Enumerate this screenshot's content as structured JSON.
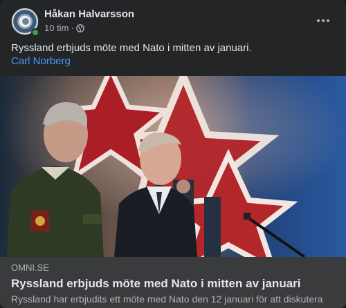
{
  "post": {
    "author": "Håkan Halvarsson",
    "time": "10 tim",
    "separator": "·",
    "privacy_icon": "globe-icon",
    "text": "Ryssland erbjuds möte med Nato i mitten av januari.",
    "mention": "Carl Norberg",
    "more_icon": "more-options-icon"
  },
  "media": {
    "description_icon": "news-photo"
  },
  "link_preview": {
    "domain": "OMNI.SE",
    "title": "Ryssland erbjuds möte med Nato i mitten av januari",
    "description": "Ryssland har erbjudits ett möte med Nato den 12 januari för att diskutera"
  },
  "colors": {
    "background": "#242526",
    "text_primary": "#e4e6eb",
    "text_secondary": "#b0b3b8",
    "link_blue": "#4599ff",
    "online_green": "#31a24c",
    "preview_bg": "#3a3b3c"
  }
}
